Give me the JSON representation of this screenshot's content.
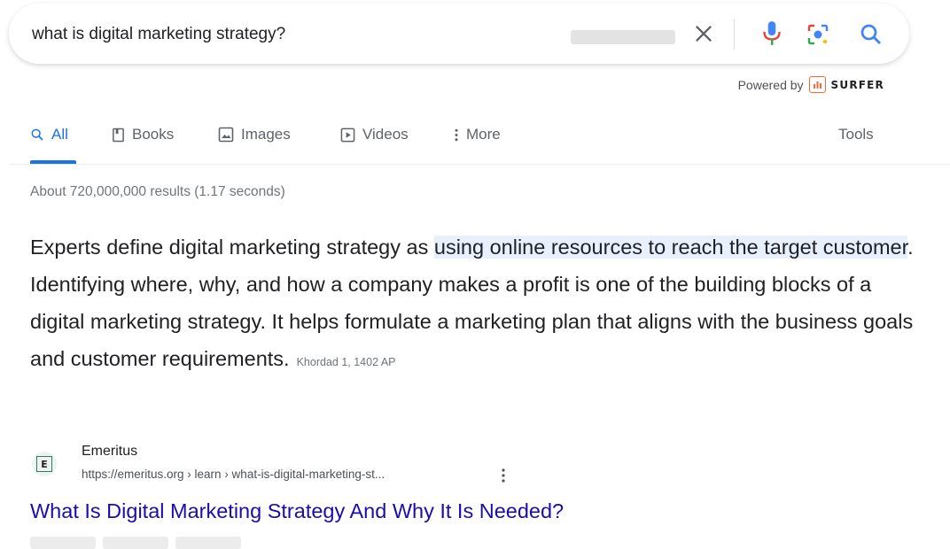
{
  "search": {
    "query": "what is digital marketing strategy?"
  },
  "powered_by": {
    "label": "Powered by",
    "brand": "SURFER"
  },
  "tabs": [
    {
      "label": "All",
      "icon": "search-icon",
      "active": true
    },
    {
      "label": "Books",
      "icon": "book-icon",
      "active": false
    },
    {
      "label": "Images",
      "icon": "image-icon",
      "active": false
    },
    {
      "label": "Videos",
      "icon": "video-icon",
      "active": false
    },
    {
      "label": "More",
      "icon": "more-vert-icon",
      "active": false
    }
  ],
  "tools_label": "Tools",
  "result_stats": "About 720,000,000 results (1.17 seconds)",
  "snippet": {
    "before": "Experts define digital marketing strategy as ",
    "highlight": "using online resources to reach the target customer",
    "after": ". Identifying where, why, and how a company makes a profit is one of the building blocks of a digital marketing strategy. It helps formulate a marketing plan that aligns with the business goals and customer requirements.",
    "date": "Khordad 1, 1402 AP"
  },
  "result": {
    "favicon_letter": "E",
    "site_name": "Emeritus",
    "url": "https://emeritus.org › learn › what-is-digital-marketing-st...",
    "title": "What Is Digital Marketing Strategy And Why It Is Needed?"
  },
  "colors": {
    "accent": "#1a73e8",
    "link": "#1a0dab",
    "highlight": "#e8f0fe",
    "surfer": "#f06a35"
  }
}
